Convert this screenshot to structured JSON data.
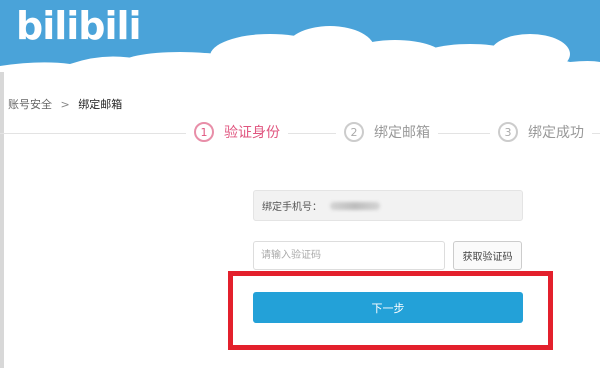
{
  "header": {
    "logo_text": "bilibili",
    "background_color": "#4aa3d9"
  },
  "breadcrumb": {
    "parent": "账号安全",
    "separator": ">",
    "current": "绑定邮箱"
  },
  "steps": [
    {
      "number": "1",
      "label": "验证身份",
      "active": true
    },
    {
      "number": "2",
      "label": "绑定邮箱",
      "active": false
    },
    {
      "number": "3",
      "label": "绑定成功",
      "active": false
    }
  ],
  "form": {
    "phone_label": "绑定手机号：",
    "code_placeholder": "请输入验证码",
    "get_code_label": "获取验证码",
    "next_label": "下一步"
  },
  "colors": {
    "accent_pink": "#e0557f",
    "primary_button": "#23a1d8",
    "highlight_red": "#e3202c"
  }
}
